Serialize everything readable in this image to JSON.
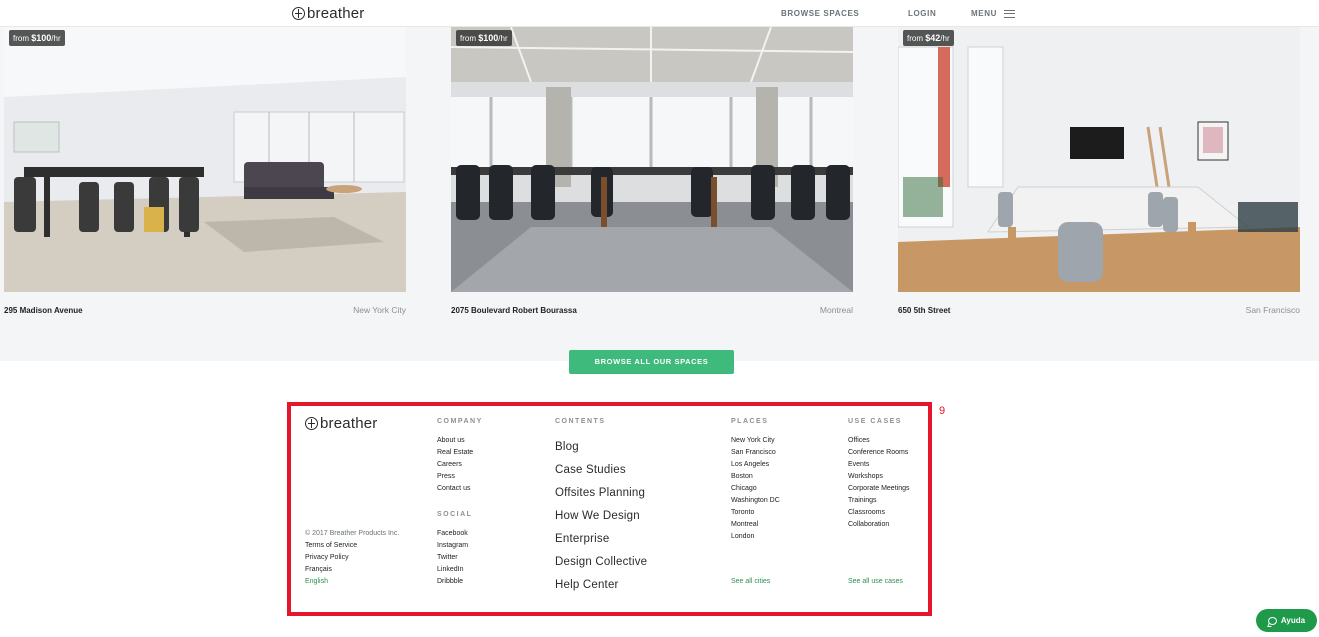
{
  "header": {
    "logo_text": "breather",
    "nav": {
      "browse": "BROWSE SPACES",
      "login": "LOGIN",
      "menu": "MENU"
    }
  },
  "listings": [
    {
      "price_prefix": "from ",
      "price": "$100",
      "price_suffix": "/hr",
      "address": "295 Madison Avenue",
      "city": "New York City"
    },
    {
      "price_prefix": "from ",
      "price": "$100",
      "price_suffix": "/hr",
      "address": "2075 Boulevard Robert Bourassa",
      "city": "Montreal"
    },
    {
      "price_prefix": "from ",
      "price": "$42",
      "price_suffix": "/hr",
      "address": "650 5th Street",
      "city": "San Francisco"
    }
  ],
  "browse_all": "BROWSE ALL OUR SPACES",
  "footer": {
    "logo_text": "breather",
    "annotation_tag": "9",
    "company": {
      "heading": "COMPANY",
      "items": [
        "About us",
        "Real Estate",
        "Careers",
        "Press",
        "Contact us"
      ]
    },
    "social": {
      "heading": "SOCIAL",
      "items": [
        "Facebook",
        "Instagram",
        "Twitter",
        "LinkedIn",
        "Dribbble"
      ]
    },
    "contents": {
      "heading": "CONTENTS",
      "items": [
        "Blog",
        "Case Studies",
        "Offsites Planning",
        "How We Design",
        "Enterprise",
        "Design Collective",
        "Help Center"
      ]
    },
    "places": {
      "heading": "PLACES",
      "items": [
        "New York City",
        "San Francisco",
        "Los Angeles",
        "Boston",
        "Chicago",
        "Washington DC",
        "Toronto",
        "Montreal",
        "London"
      ],
      "see_all": "See all cities"
    },
    "use_cases": {
      "heading": "USE CASES",
      "items": [
        "Offices",
        "Conference Rooms",
        "Events",
        "Workshops",
        "Corporate Meetings",
        "Trainings",
        "Classrooms",
        "Collaboration"
      ],
      "see_all": "See all use cases"
    },
    "legal": {
      "copyright": "© 2017 Breather Products Inc.",
      "terms": "Terms of Service",
      "privacy": "Privacy Policy",
      "lang_fr": "Français",
      "lang_en": "English"
    }
  },
  "help_button": "Ayuda",
  "colors": {
    "accent_green": "#3dba7c",
    "help_green": "#1f9a4b",
    "frame_red": "#e3162b"
  }
}
